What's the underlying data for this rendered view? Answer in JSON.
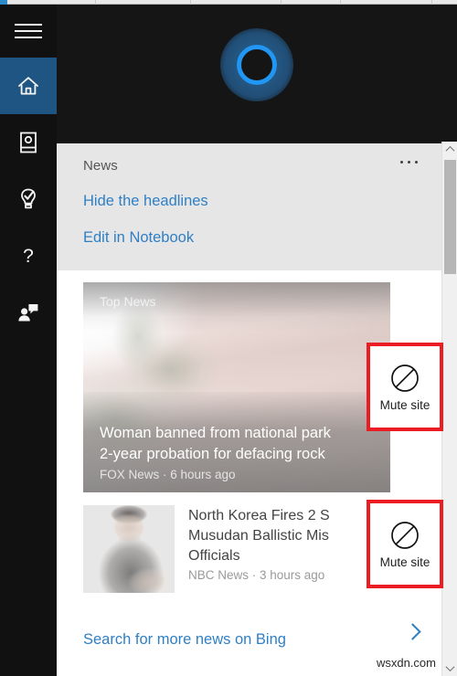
{
  "window": {
    "accent_color": "#2e8bc9",
    "rail_background": "#111111",
    "active_item_color": "#1f5582",
    "link_color": "#2f7fc4",
    "annotation_color": "#ec1c24"
  },
  "rail": {
    "menu": {
      "label": "Menu",
      "icon": "hamburger-menu-icon"
    },
    "items": [
      {
        "id": "home",
        "label": "Home",
        "icon": "home-icon",
        "active": true
      },
      {
        "id": "notebook",
        "label": "Notebook",
        "icon": "notebook-icon",
        "active": false
      },
      {
        "id": "reminders",
        "label": "Reminders",
        "icon": "lightbulb-check-icon",
        "active": false
      },
      {
        "id": "help",
        "label": "Help",
        "icon": "question-mark-icon",
        "active": false
      },
      {
        "id": "feedback",
        "label": "Feedback",
        "icon": "person-speech-bubble-icon",
        "active": false
      }
    ]
  },
  "header": {
    "logo": "cortana-ring-logo",
    "ring_color": "#2196f3",
    "halo_color": "#245a88"
  },
  "news_card": {
    "title": "News",
    "overflow_menu": "…",
    "links": [
      {
        "id": "hide-headlines",
        "label": "Hide the headlines"
      },
      {
        "id": "edit-notebook",
        "label": "Edit in Notebook"
      }
    ]
  },
  "top_news": {
    "badge": "Top News",
    "headline_line1": "Woman banned from national park",
    "headline_line2": "2-year probation for defacing rock",
    "source": "FOX News · 6 hours ago",
    "image_alt": "sandstone-canyon-rock-photo"
  },
  "news_items": [
    {
      "headline_line1": "North Korea Fires 2 S",
      "headline_line2": "Musudan Ballistic Mis",
      "headline_line3": "Officials",
      "source": "NBC News · 3 hours ago",
      "image_alt": "kim-jong-un-portrait-thumbnail"
    }
  ],
  "footer": {
    "bing_link": "Search for more news on Bing",
    "chevron": "chevron-right-icon"
  },
  "scrollbar": {
    "up_arrow": "scroll-up-arrow",
    "down_arrow": "scroll-down-arrow",
    "thumb": "scrollbar-thumb"
  },
  "annotations": [
    {
      "id": "mute-site-1",
      "label": "Mute site",
      "icon": "prohibition-circle-icon"
    },
    {
      "id": "mute-site-2",
      "label": "Mute site",
      "icon": "prohibition-circle-icon"
    }
  ],
  "watermark": {
    "text": "wsxdn.com"
  }
}
